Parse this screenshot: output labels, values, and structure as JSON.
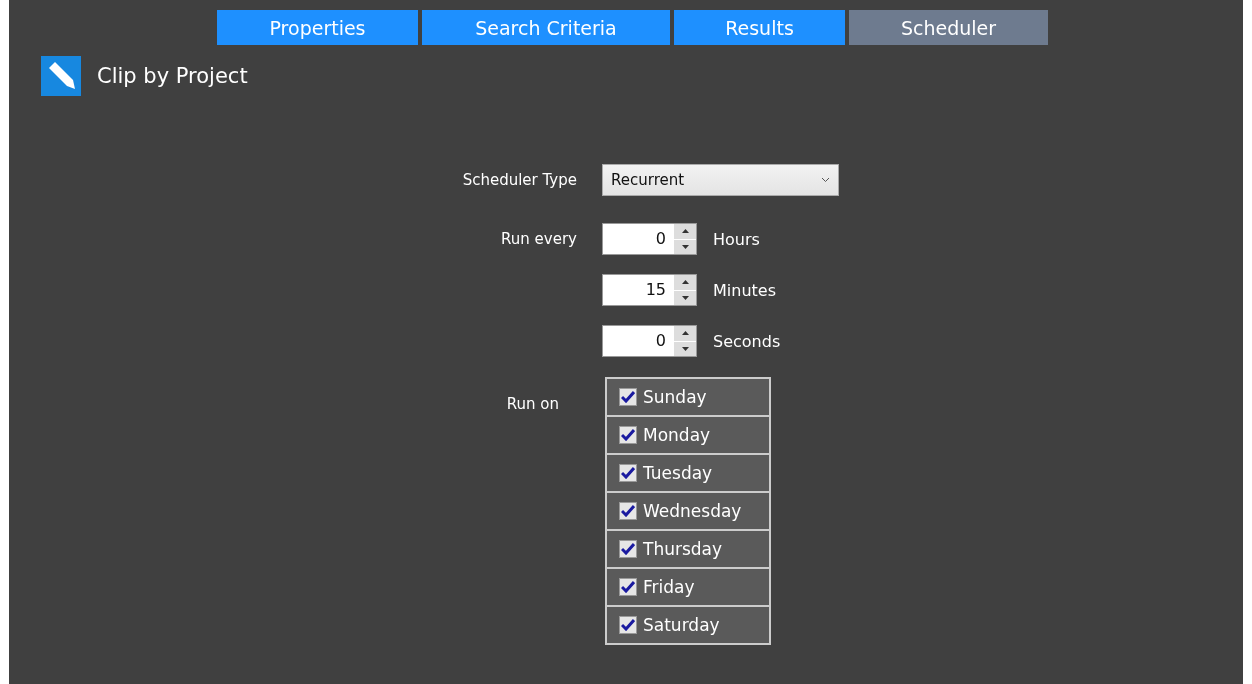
{
  "tabs": [
    {
      "label": "Properties",
      "selected": false
    },
    {
      "label": "Search Criteria",
      "selected": false
    },
    {
      "label": "Results",
      "selected": false
    },
    {
      "label": "Scheduler",
      "selected": true
    }
  ],
  "header": {
    "title": "Clip by Project"
  },
  "scheduler_type": {
    "label": "Scheduler Type",
    "value": "Recurrent"
  },
  "run_every": {
    "label": "Run every",
    "fields": [
      {
        "value": "0",
        "unit": "Hours"
      },
      {
        "value": "15",
        "unit": "Minutes"
      },
      {
        "value": "0",
        "unit": "Seconds"
      }
    ]
  },
  "run_on": {
    "label": "Run on",
    "days": [
      {
        "label": "Sunday",
        "checked": true
      },
      {
        "label": "Monday",
        "checked": true
      },
      {
        "label": "Tuesday",
        "checked": true
      },
      {
        "label": "Wednesday",
        "checked": true
      },
      {
        "label": "Thursday",
        "checked": true
      },
      {
        "label": "Friday",
        "checked": true
      },
      {
        "label": "Saturday",
        "checked": true
      }
    ]
  }
}
